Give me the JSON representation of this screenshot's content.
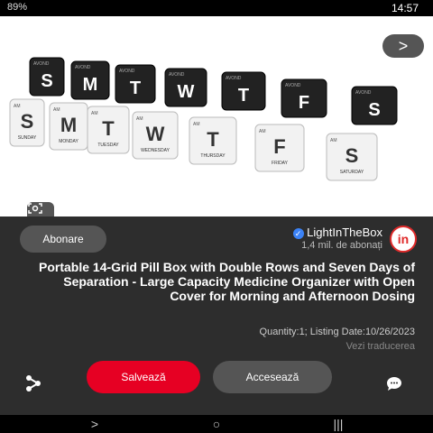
{
  "status_bar": {
    "time": "14:57",
    "system_text": "89%"
  },
  "pin_image": {
    "top_row_letters": [
      "S",
      "F",
      "T",
      "W",
      "T",
      "M",
      "S"
    ],
    "bottom_row_letters": [
      "S",
      "F",
      "T",
      "W",
      "T",
      "M",
      "S"
    ],
    "top_tag": "AVOND",
    "bottom_days": [
      "SATURDAY",
      "FRIDAY",
      "THURSDAY",
      "WEDNESDAY",
      "TUESDAY",
      "MONDAY",
      "SUNDAY"
    ],
    "bottom_tag": "AM"
  },
  "close_button": {
    "label": ">"
  },
  "creator": {
    "name": "LightInTheBox",
    "followers": "1,4 mil. de abonați",
    "avatar_text": "in"
  },
  "follow_button": {
    "label": "Abonare"
  },
  "title": "Portable 14-Grid Pill Box with Double Rows and Seven Days of Separation - Large Capacity Medicine Organizer with Open Cover for Morning and Afternoon Dosing",
  "meta": "Quantity:1; Listing Date:10/26/2023",
  "translate_link": "Vezi traducerea",
  "buttons": {
    "save": "Salvează",
    "access": "Accesează"
  },
  "colors": {
    "save": "#e60023",
    "panel": "#2d2d2d"
  }
}
